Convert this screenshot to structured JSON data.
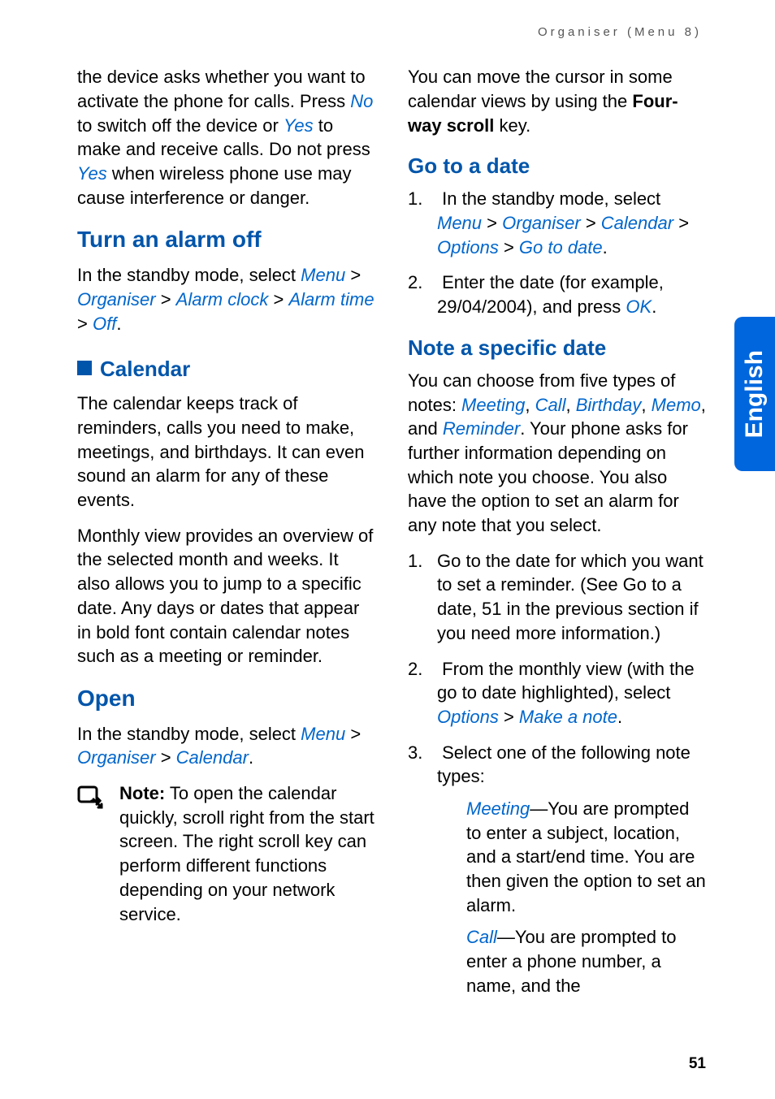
{
  "header": "Organiser (Menu 8)",
  "side_tab": "English",
  "page_number": "51",
  "left": {
    "intro_p1_a": "the device asks whether you want to activate the phone for calls. Press ",
    "intro_p1_no": "No",
    "intro_p1_b": " to switch off the device or ",
    "intro_p1_yes1": "Yes",
    "intro_p1_c": " to make and receive calls. Do not press ",
    "intro_p1_yes2": "Yes",
    "intro_p1_d": " when wireless phone use may cause interference or danger.",
    "h_turn_off": "Turn an alarm off",
    "turn_off_a": "In the standby mode, select ",
    "turn_off_menu": "Menu",
    "turn_off_gt1": " > ",
    "turn_off_organiser": "Organiser",
    "turn_off_gt2": " > ",
    "turn_off_alarm": "Alarm clock",
    "turn_off_gt3": " > ",
    "turn_off_alarmtime": "Alarm time",
    "turn_off_gt4": " > ",
    "turn_off_off": "Off",
    "turn_off_dot": ".",
    "h_calendar": "Calendar",
    "cal_p1": "The calendar keeps track of reminders, calls you need to make, meetings, and birthdays. It can even sound an alarm for any of these events.",
    "cal_p2": "Monthly view provides an overview of the selected month and weeks. It also allows you to jump to a specific date. Any days or dates that appear in bold font contain calendar notes such as a meeting or reminder.",
    "h_open": "Open",
    "open_a": "In the standby mode, select ",
    "open_menu": "Menu",
    "open_gt1": " > ",
    "open_organiser": "Organiser",
    "open_gt2": " > ",
    "open_calendar": "Calendar",
    "open_dot": ".",
    "note_bold": "Note:",
    "note_text": " To open the calendar quickly, scroll right from the start screen. The right scroll key can perform different functions depending on your network service."
  },
  "right": {
    "p1_a": "You can move the cursor in some calendar views by using the ",
    "p1_bold": "Four-way scroll",
    "p1_b": " key.",
    "h_goto": "Go to a date",
    "goto_li1_a": "In the standby mode, select ",
    "goto_li1_menu": "Menu",
    "goto_li1_gt1": " > ",
    "goto_li1_organiser": "Organiser",
    "goto_li1_gt2": " > ",
    "goto_li1_calendar": "Calendar",
    "goto_li1_gt3": " > ",
    "goto_li1_options": "Options",
    "goto_li1_gt4": " > ",
    "goto_li1_gotodate": "Go to date",
    "goto_li1_dot": ".",
    "goto_li2_a": "Enter the date (for example, 29/04/2004), and press ",
    "goto_li2_ok": "OK",
    "goto_li2_dot": ".",
    "h_notedate": "Note a specific date",
    "nd_p1_a": "You can choose from five types of notes: ",
    "nd_meeting": "Meeting",
    "nd_c1": ", ",
    "nd_call": "Call",
    "nd_c2": ", ",
    "nd_birthday": "Birthday",
    "nd_c3": ", ",
    "nd_memo": "Memo",
    "nd_c4": ", and ",
    "nd_reminder": "Reminder",
    "nd_p1_b": ". Your phone asks for further information depending on which note you choose. You also have the option to set an alarm for any note that you select.",
    "nd_li1": "Go to the date for which you want to set a reminder. (See Go to a date, 51 in the previous section if you need more information.)",
    "nd_li2_a": "From the monthly view (with the go to date highlighted), select ",
    "nd_li2_options": "Options",
    "nd_li2_gt": " > ",
    "nd_li2_make": "Make a note",
    "nd_li2_dot": ".",
    "nd_li3_a": "Select one of the following note types:",
    "nd_li3_meeting": "Meeting",
    "nd_li3_meeting_b": "—You are prompted to enter a subject, location, and a start/end time. You are then given the option to set an alarm.",
    "nd_li3_call": "Call",
    "nd_li3_call_b": "—You are prompted to enter a phone number, a name, and the"
  }
}
